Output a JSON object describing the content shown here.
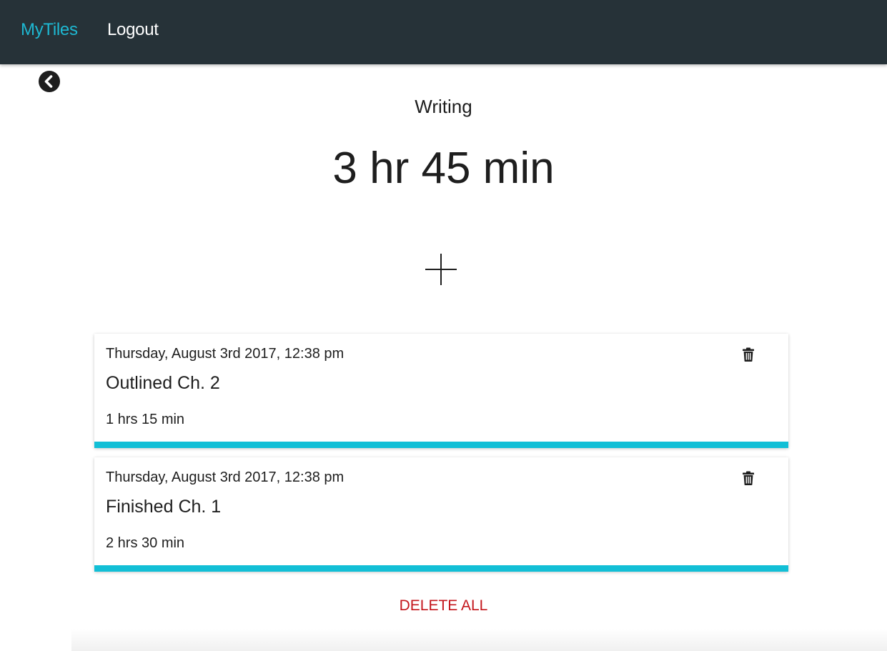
{
  "navbar": {
    "brand": "MyTiles",
    "logout_label": "Logout",
    "background": "#263238",
    "brand_color": "#1eb8d2"
  },
  "back_button": {
    "icon": "chevron-left-circle-icon"
  },
  "tile": {
    "title": "Writing",
    "total": "3 hr 45 min",
    "add_icon": "plus-icon"
  },
  "entries": [
    {
      "date": "Thursday, August 3rd 2017, 12:38 pm",
      "name": "Outlined Ch. 2",
      "duration": "1 hrs 15 min",
      "delete_icon": "trash-icon"
    },
    {
      "date": "Thursday, August 3rd 2017, 12:38 pm",
      "name": "Finished Ch. 1",
      "duration": "2 hrs 30 min",
      "delete_icon": "trash-icon"
    }
  ],
  "accent_color": "#12bfd6",
  "delete_all_label": "DELETE ALL",
  "delete_color": "#c4161c"
}
